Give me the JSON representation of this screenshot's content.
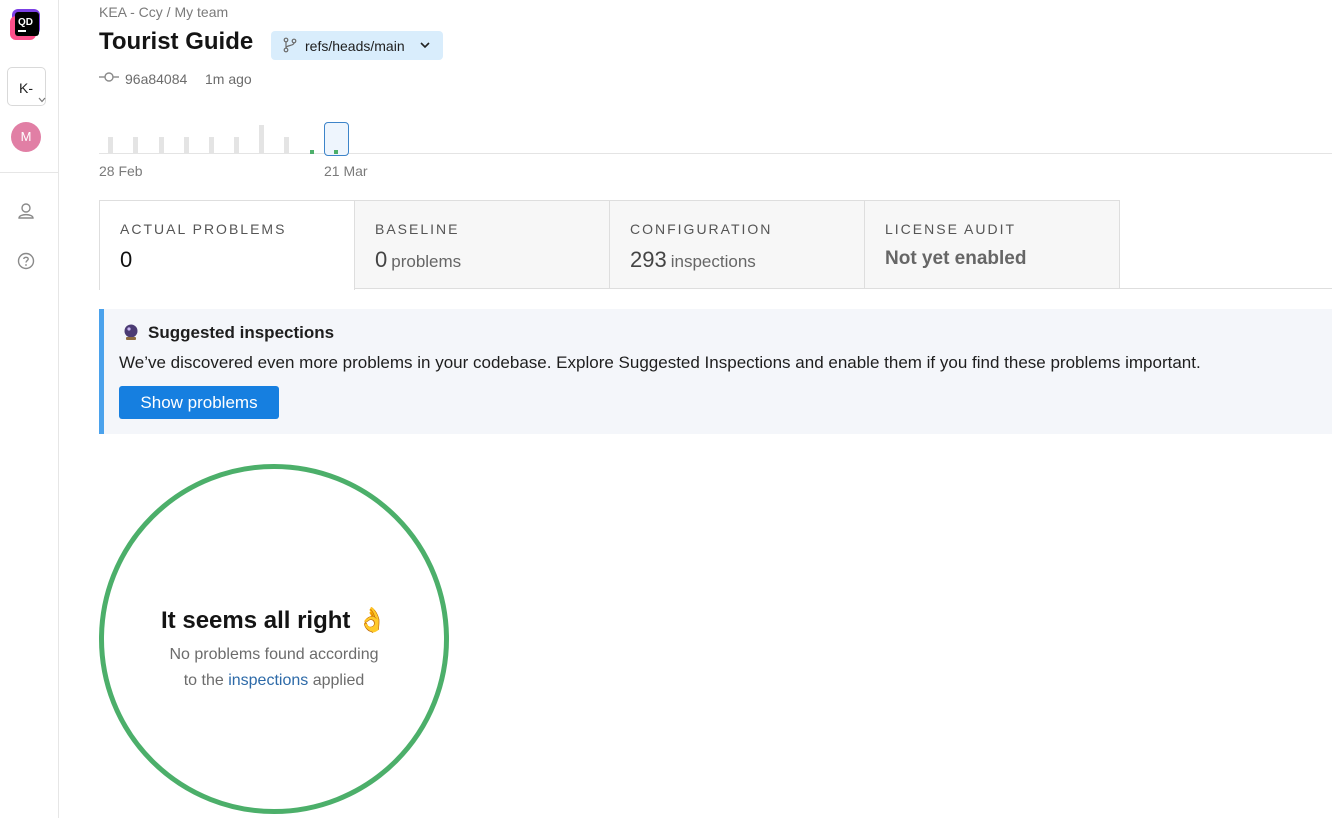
{
  "app": {
    "logo_text": "QD",
    "project_switch_label": "K-",
    "user_initial": "M"
  },
  "header": {
    "breadcrumb": "KEA - Ccy / My team",
    "title": "Tourist Guide",
    "branch": "refs/heads/main",
    "commit_hash": "96a84084",
    "commit_time": "1m ago"
  },
  "timeline": {
    "start_label": "28 Feb",
    "end_label": "21 Mar",
    "runs": [
      {
        "date": "28 Feb"
      },
      {
        "date": ""
      },
      {
        "date": ""
      },
      {
        "date": ""
      },
      {
        "date": ""
      },
      {
        "date": ""
      },
      {
        "date": ""
      },
      {
        "date": ""
      },
      {
        "date": ""
      },
      {
        "date": "21 Mar",
        "selected": true
      }
    ]
  },
  "tabs": [
    {
      "name": "ACTUAL PROBLEMS",
      "value": "0",
      "unit": "",
      "active": true
    },
    {
      "name": "BASELINE",
      "value": "0",
      "unit": "problems",
      "active": false
    },
    {
      "name": "CONFIGURATION",
      "value": "293",
      "unit": "inspections",
      "active": false
    },
    {
      "name": "LICENSE AUDIT",
      "value": "Not yet enabled",
      "unit": "",
      "active": false
    }
  ],
  "banner": {
    "title": "Suggested inspections",
    "text": "We’ve discovered even more problems in your codebase. Explore Suggested Inspections and enable them if you find these problems important.",
    "button": "Show problems"
  },
  "empty_state": {
    "title": "It seems all right 👌",
    "line1": "No problems found according",
    "line2_prefix": "to the",
    "line2_link": "inspections",
    "line2_suffix": "applied"
  },
  "colors": {
    "accent": "#167fe0",
    "banner_border": "#4ba2ec",
    "success": "#4caf6a",
    "branch_bg": "#d9edfc"
  }
}
